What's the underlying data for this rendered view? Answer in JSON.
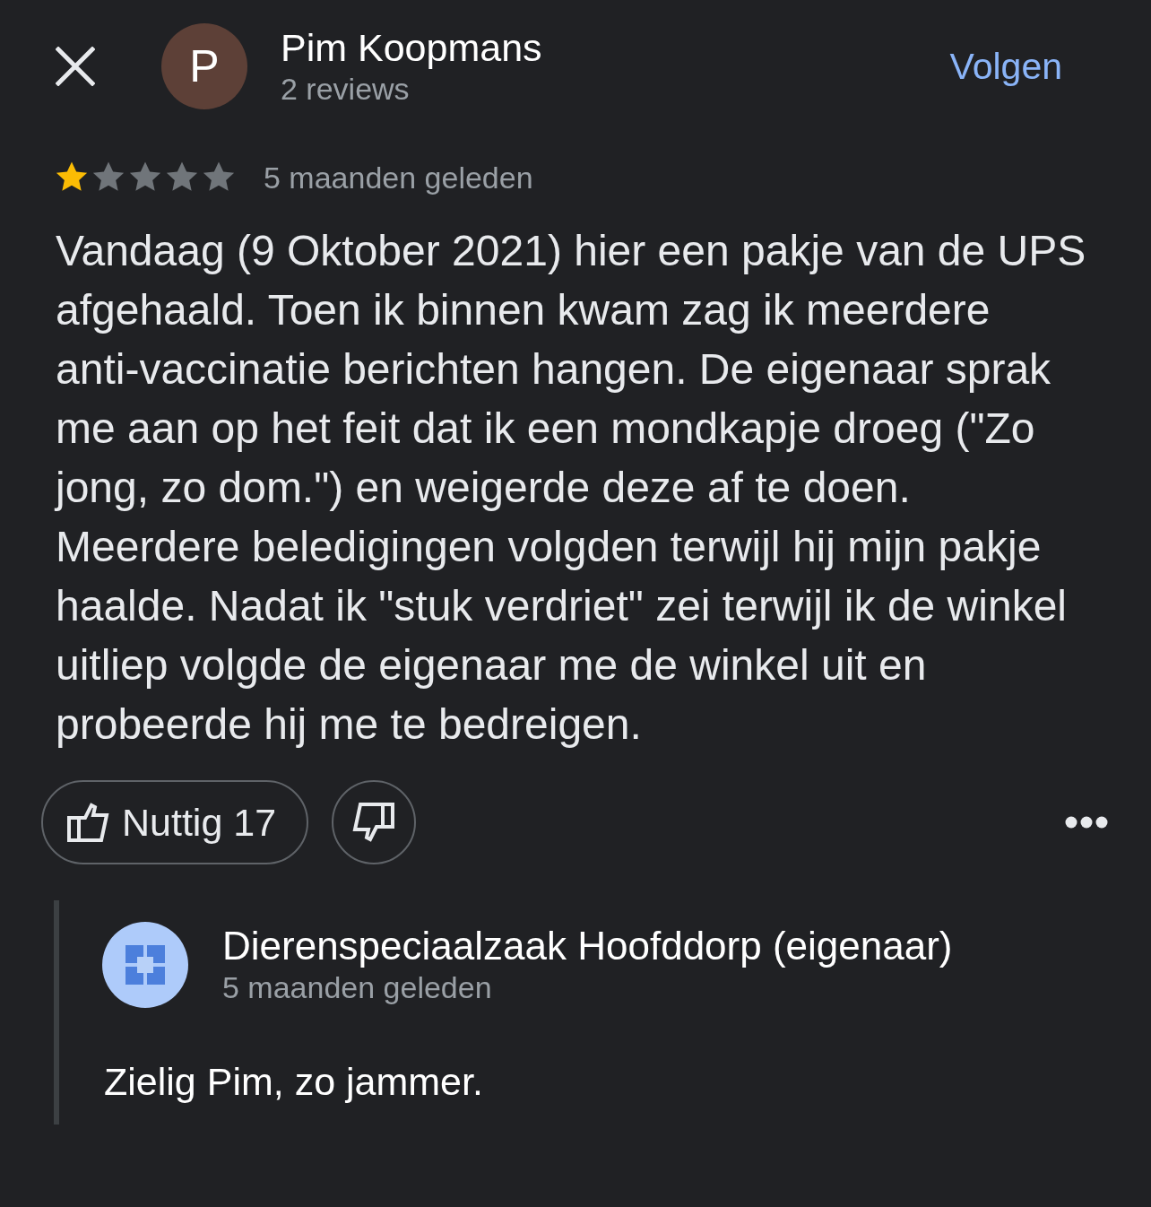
{
  "header": {
    "avatar_initial": "P",
    "name": "Pim Koopmans",
    "review_count": "2 reviews",
    "follow_button": "Volgen"
  },
  "review": {
    "stars": 1,
    "time": "5 maanden geleden",
    "text": "Vandaag (9 Oktober 2021) hier een pakje van de UPS afgehaald. Toen ik binnen kwam zag ik meerdere anti-vaccinatie berichten hangen. De eigenaar sprak me aan op het feit dat ik een mondkapje droeg (\"Zo jong, zo dom.\") en weigerde deze af te doen. Meerdere beledigingen volgden terwijl hij mijn pakje haalde. Nadat ik \"stuk verdriet\" zei terwijl ik de winkel uitliep volgde de eigenaar me de winkel uit en probeerde hij me te bedreigen."
  },
  "actions": {
    "helpful_button": "Nuttig 17"
  },
  "owner_reply": {
    "name": "Dierenspeciaalzaak Hoofddorp (eigenaar)",
    "time": "5 maanden geleden",
    "text": "Zielig Pim, zo jammer."
  }
}
